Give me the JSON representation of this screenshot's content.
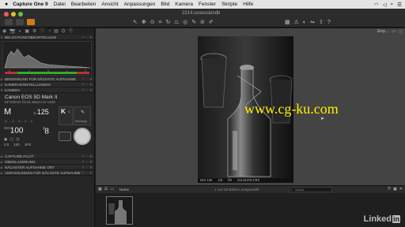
{
  "menubar": {
    "apple": "",
    "items": [
      "Capture One 9",
      "Datei",
      "Bearbeiten",
      "Ansicht",
      "Anpassungen",
      "Bild",
      "Kamera",
      "Fenster",
      "Skripte",
      "Hilfe"
    ],
    "status_icons": [
      "wifi-icon",
      "volume-icon",
      "search-icon",
      "menu-icon"
    ]
  },
  "toolbar": {
    "document_title": "2214.cosessiondb",
    "colors": {
      "close": "#ec5f56",
      "minimize": "#e6bd2f",
      "zoom": "#63c446",
      "accent": "#d07a1a"
    }
  },
  "tool_tabs": [
    "◉",
    "📷",
    "◐",
    "▣",
    "⚙",
    "ⓘ",
    "◔",
    "▤",
    "⛭",
    "ⓔ"
  ],
  "sections": {
    "histogram": "BELICHTUNGSBEURTEILUNG",
    "naming": "BENENNUNG FÜR NÄCHSTE AUFNAHME",
    "camera_settings": "KAMERAEINSTELLUNGEN",
    "camera": "KAMERA",
    "pilot": "CAPTURE PILOT",
    "overlay": "ÜBERLAGERUNG",
    "next_location": "NÄCHSTER AUFNAHME ORT",
    "adjustments": "ANPASSUNGEN FÜR NÄCHSTE AUFNAHME"
  },
  "histogram": {
    "ticks": [
      "-2",
      "-1",
      "0",
      "1",
      "2"
    ]
  },
  "camera": {
    "name": "Canon EOS 5D Mark II",
    "lens": "EF100mm f/2.8L Macro IS USM",
    "mode": "M",
    "shutter_prefix": "1/",
    "shutter": "125",
    "iso_prefix": "ISO",
    "iso": "100",
    "aperture_prefix": "f",
    "aperture": "8",
    "wb_label": "K",
    "wb_sub": "C",
    "wb_picker_label": "Weißabgl.",
    "small_values": [
      "0.0",
      "100",
      "JPG"
    ]
  },
  "viewer": {
    "zoom": "Einp...",
    "status": {
      "iso": "ISO 100",
      "shutter": "1/8",
      "aperture": "f/8",
      "filename": "22142479.CR2"
    },
    "watermark": "www.cg-ku.com"
  },
  "browser": {
    "sort_label": "Name",
    "count": "1 von 53 Bildern ausgewählt",
    "search_placeholder": "Suche",
    "brand": "Linked",
    "brand_in": "in"
  }
}
